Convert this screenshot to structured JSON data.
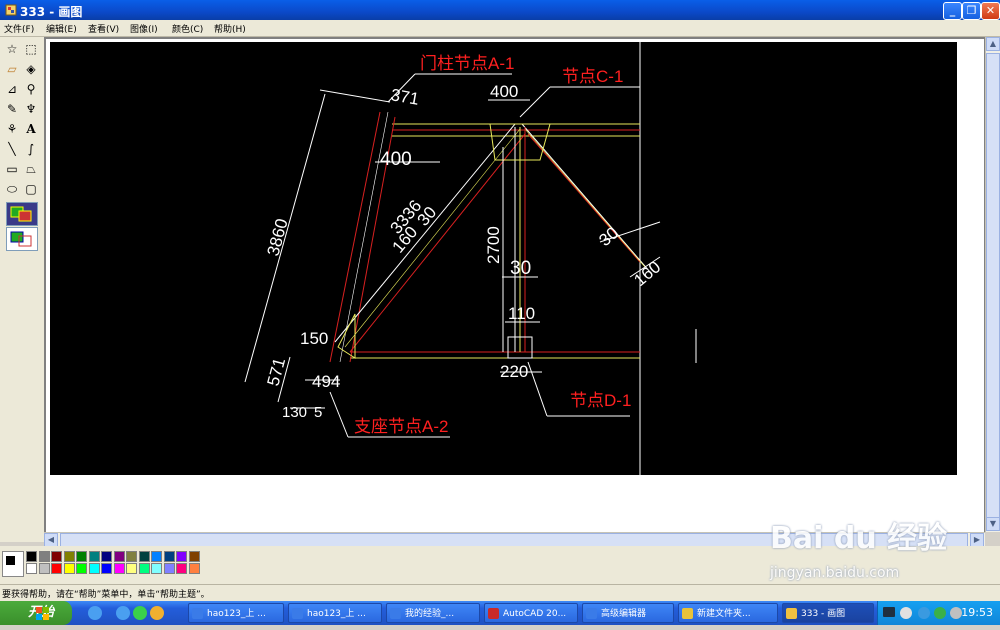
{
  "window": {
    "title": "333 - 画图",
    "minimize_label": "_",
    "maximize_label": "❐",
    "close_label": "✕"
  },
  "menu": [
    {
      "label": "文件(F)"
    },
    {
      "label": "编辑(E)"
    },
    {
      "label": "查看(V)"
    },
    {
      "label": "图像(I)"
    },
    {
      "label": "颜色(C)"
    },
    {
      "label": "帮助(H)"
    }
  ],
  "tools": [
    {
      "name": "free-select-icon",
      "glyph": "☆"
    },
    {
      "name": "rect-select-icon",
      "glyph": "⬚"
    },
    {
      "name": "eraser-icon",
      "glyph": "▱"
    },
    {
      "name": "fill-icon",
      "glyph": "◈"
    },
    {
      "name": "eyedropper-icon",
      "glyph": "⊿"
    },
    {
      "name": "magnifier-icon",
      "glyph": "⚲"
    },
    {
      "name": "pencil-icon",
      "glyph": "✎"
    },
    {
      "name": "brush-icon",
      "glyph": "♆"
    },
    {
      "name": "airbrush-icon",
      "glyph": "⚘"
    },
    {
      "name": "text-icon",
      "glyph": "A"
    },
    {
      "name": "line-icon",
      "glyph": "╲"
    },
    {
      "name": "curve-icon",
      "glyph": "∫"
    },
    {
      "name": "rectangle-icon",
      "glyph": "▭"
    },
    {
      "name": "polygon-icon",
      "glyph": "⏢"
    },
    {
      "name": "ellipse-icon",
      "glyph": "⬭"
    },
    {
      "name": "rounded-rect-icon",
      "glyph": "▢"
    }
  ],
  "drawing": {
    "labels_red": {
      "gate_node": "门柱节点A-1",
      "node_c": "节点C-1",
      "node_d": "节点D-1",
      "support_node": "支座节点A-2"
    },
    "dims": {
      "d371": "371",
      "d400_top": "400",
      "d400_left": "400",
      "d3860": "3860",
      "d3336": "3336",
      "d30_a": "30",
      "d160_a": "160",
      "d2700": "2700",
      "d30_b": "30",
      "d110": "110",
      "d30_c": "30",
      "d160_b": "160",
      "d150": "150",
      "d571": "571",
      "d494": "494",
      "d130": "130",
      "d5": "5",
      "d220": "220"
    }
  },
  "palette": {
    "row1": [
      "#000000",
      "#808080",
      "#800000",
      "#808000",
      "#008000",
      "#008080",
      "#000080",
      "#800080",
      "#808040",
      "#004040",
      "#0080ff",
      "#004080",
      "#8000ff",
      "#804000"
    ],
    "row2": [
      "#ffffff",
      "#c0c0c0",
      "#ff0000",
      "#ffff00",
      "#00ff00",
      "#00ffff",
      "#0000ff",
      "#ff00ff",
      "#ffff80",
      "#00ff80",
      "#80ffff",
      "#8080ff",
      "#ff0080",
      "#ff8040"
    ]
  },
  "status": {
    "text": "要获得帮助，请在“帮助”菜单中，单击“帮助主题”。"
  },
  "taskbar": {
    "start_label": "开始",
    "tasks": [
      {
        "label": "hao123_上 ...",
        "color": "#3a7be8"
      },
      {
        "label": "hao123_上 ...",
        "color": "#3a7be8"
      },
      {
        "label": "我的经验_...",
        "color": "#3a7be8"
      },
      {
        "label": "AutoCAD 20...",
        "color": "#c92a2a"
      },
      {
        "label": "高级编辑器",
        "color": "#3a7be8"
      },
      {
        "label": "新建文件夹...",
        "color": "#e8c23a"
      },
      {
        "label": "333 - 画图",
        "color": "#f0c040"
      }
    ],
    "clock": "19:53"
  },
  "watermark": {
    "brand": "Bai du 经验",
    "url": "jingyan.baidu.com"
  }
}
